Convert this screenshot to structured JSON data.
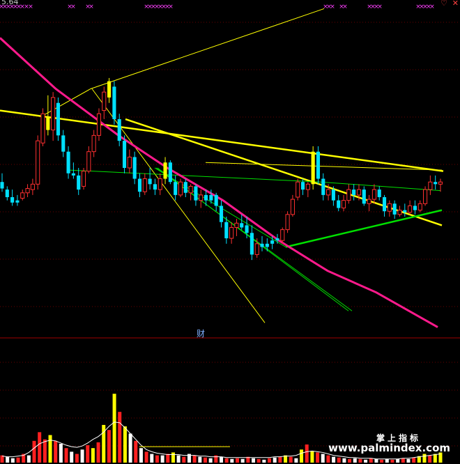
{
  "header": {
    "price": "5.64"
  },
  "indicator": {
    "label": "财"
  },
  "watermark": {
    "brand": "掌上指标",
    "url": "www.palmindex.com"
  },
  "colors": {
    "up": "#ff3030",
    "down": "#00e0ff",
    "highlight": "#ffff00",
    "ma_pink": "#ff1a8c",
    "trend_yellow": "#ffff00",
    "trend_green": "#00e000",
    "vol_up": "#ff2020",
    "vol_hl": "#ffff00",
    "vol_ma": "#ffffff",
    "marker": "#ff40ff"
  },
  "chart_data": {
    "type": "candlestick",
    "title": "",
    "ylim": [
      3.7,
      6.8
    ],
    "candles": [
      {
        "o": 5.12,
        "h": 5.2,
        "l": 5.03,
        "c": 5.06,
        "t": "d"
      },
      {
        "o": 5.05,
        "h": 5.08,
        "l": 4.95,
        "c": 4.98,
        "t": "d"
      },
      {
        "o": 4.98,
        "h": 5.05,
        "l": 4.9,
        "c": 4.93,
        "t": "d"
      },
      {
        "o": 4.93,
        "h": 5.0,
        "l": 4.9,
        "c": 4.95,
        "t": "d"
      },
      {
        "o": 4.97,
        "h": 5.05,
        "l": 4.95,
        "c": 5.02,
        "t": "u"
      },
      {
        "o": 5.02,
        "h": 5.1,
        "l": 4.98,
        "c": 5.06,
        "t": "u"
      },
      {
        "o": 5.05,
        "h": 5.15,
        "l": 5.0,
        "c": 5.1,
        "t": "u"
      },
      {
        "o": 5.1,
        "h": 5.55,
        "l": 5.05,
        "c": 5.5,
        "t": "u"
      },
      {
        "o": 5.48,
        "h": 5.8,
        "l": 5.45,
        "c": 5.75,
        "t": "u"
      },
      {
        "o": 5.72,
        "h": 5.92,
        "l": 5.55,
        "c": 5.6,
        "t": "h"
      },
      {
        "o": 5.6,
        "h": 5.95,
        "l": 5.5,
        "c": 5.9,
        "t": "u"
      },
      {
        "o": 5.85,
        "h": 5.9,
        "l": 5.5,
        "c": 5.55,
        "t": "d"
      },
      {
        "o": 5.55,
        "h": 5.6,
        "l": 5.35,
        "c": 5.4,
        "t": "d"
      },
      {
        "o": 5.4,
        "h": 5.45,
        "l": 5.15,
        "c": 5.2,
        "t": "d"
      },
      {
        "o": 5.2,
        "h": 5.3,
        "l": 5.15,
        "c": 5.18,
        "t": "d"
      },
      {
        "o": 5.18,
        "h": 5.25,
        "l": 5.0,
        "c": 5.05,
        "t": "d"
      },
      {
        "o": 5.08,
        "h": 5.25,
        "l": 5.05,
        "c": 5.22,
        "t": "u"
      },
      {
        "o": 5.22,
        "h": 5.45,
        "l": 5.2,
        "c": 5.4,
        "t": "u"
      },
      {
        "o": 5.4,
        "h": 5.6,
        "l": 5.35,
        "c": 5.55,
        "t": "u"
      },
      {
        "o": 5.55,
        "h": 5.8,
        "l": 5.5,
        "c": 5.75,
        "t": "u"
      },
      {
        "o": 5.78,
        "h": 6.0,
        "l": 5.7,
        "c": 5.95,
        "t": "u"
      },
      {
        "o": 5.9,
        "h": 6.08,
        "l": 5.85,
        "c": 6.05,
        "t": "h"
      },
      {
        "o": 6.0,
        "h": 6.05,
        "l": 5.65,
        "c": 5.7,
        "t": "d"
      },
      {
        "o": 5.7,
        "h": 5.75,
        "l": 5.45,
        "c": 5.5,
        "t": "d"
      },
      {
        "o": 5.5,
        "h": 5.55,
        "l": 5.2,
        "c": 5.25,
        "t": "d"
      },
      {
        "o": 5.25,
        "h": 5.42,
        "l": 5.2,
        "c": 5.35,
        "t": "u"
      },
      {
        "o": 5.35,
        "h": 5.4,
        "l": 5.1,
        "c": 5.15,
        "t": "d"
      },
      {
        "o": 5.15,
        "h": 5.2,
        "l": 4.98,
        "c": 5.03,
        "t": "d"
      },
      {
        "o": 5.03,
        "h": 5.2,
        "l": 5.0,
        "c": 5.15,
        "t": "u"
      },
      {
        "o": 5.15,
        "h": 5.25,
        "l": 5.05,
        "c": 5.1,
        "t": "d"
      },
      {
        "o": 5.1,
        "h": 5.15,
        "l": 5.0,
        "c": 5.05,
        "t": "d"
      },
      {
        "o": 5.05,
        "h": 5.2,
        "l": 5.0,
        "c": 5.15,
        "t": "u"
      },
      {
        "o": 5.15,
        "h": 5.35,
        "l": 5.1,
        "c": 5.3,
        "t": "h"
      },
      {
        "o": 5.3,
        "h": 5.32,
        "l": 5.1,
        "c": 5.12,
        "t": "d"
      },
      {
        "o": 5.12,
        "h": 5.18,
        "l": 4.95,
        "c": 5.0,
        "t": "d"
      },
      {
        "o": 5.0,
        "h": 5.15,
        "l": 4.98,
        "c": 5.12,
        "t": "u"
      },
      {
        "o": 5.12,
        "h": 5.15,
        "l": 4.98,
        "c": 5.02,
        "t": "d"
      },
      {
        "o": 5.02,
        "h": 5.1,
        "l": 4.95,
        "c": 5.08,
        "t": "u"
      },
      {
        "o": 5.08,
        "h": 5.1,
        "l": 4.9,
        "c": 4.95,
        "t": "d"
      },
      {
        "o": 4.95,
        "h": 5.05,
        "l": 4.88,
        "c": 5.0,
        "t": "u"
      },
      {
        "o": 5.0,
        "h": 5.05,
        "l": 4.9,
        "c": 4.95,
        "t": "d"
      },
      {
        "o": 4.95,
        "h": 5.05,
        "l": 4.92,
        "c": 5.0,
        "t": "d"
      },
      {
        "o": 5.0,
        "h": 5.02,
        "l": 4.85,
        "c": 4.9,
        "t": "d"
      },
      {
        "o": 4.9,
        "h": 4.95,
        "l": 4.7,
        "c": 4.75,
        "t": "d"
      },
      {
        "o": 4.75,
        "h": 4.8,
        "l": 4.55,
        "c": 4.6,
        "t": "d"
      },
      {
        "o": 4.6,
        "h": 4.75,
        "l": 4.55,
        "c": 4.7,
        "t": "u"
      },
      {
        "o": 4.7,
        "h": 4.78,
        "l": 4.62,
        "c": 4.74,
        "t": "u"
      },
      {
        "o": 4.74,
        "h": 4.82,
        "l": 4.68,
        "c": 4.7,
        "t": "d"
      },
      {
        "o": 4.72,
        "h": 4.8,
        "l": 4.6,
        "c": 4.65,
        "t": "d"
      },
      {
        "o": 4.65,
        "h": 4.72,
        "l": 4.4,
        "c": 4.45,
        "t": "d"
      },
      {
        "o": 4.45,
        "h": 4.6,
        "l": 4.42,
        "c": 4.55,
        "t": "u"
      },
      {
        "o": 4.55,
        "h": 4.62,
        "l": 4.48,
        "c": 4.52,
        "t": "d"
      },
      {
        "o": 4.52,
        "h": 4.6,
        "l": 4.48,
        "c": 4.55,
        "t": "d"
      },
      {
        "o": 4.55,
        "h": 4.62,
        "l": 4.5,
        "c": 4.58,
        "t": "d"
      },
      {
        "o": 4.58,
        "h": 4.64,
        "l": 4.55,
        "c": 4.6,
        "t": "d"
      },
      {
        "o": 4.58,
        "h": 4.7,
        "l": 4.55,
        "c": 4.68,
        "t": "u"
      },
      {
        "o": 4.68,
        "h": 4.85,
        "l": 4.65,
        "c": 4.82,
        "t": "u"
      },
      {
        "o": 4.82,
        "h": 5.0,
        "l": 4.8,
        "c": 4.96,
        "t": "u"
      },
      {
        "o": 4.98,
        "h": 5.15,
        "l": 4.95,
        "c": 5.12,
        "t": "u"
      },
      {
        "o": 5.12,
        "h": 5.15,
        "l": 5.0,
        "c": 5.05,
        "t": "d"
      },
      {
        "o": 5.05,
        "h": 5.12,
        "l": 4.98,
        "c": 5.1,
        "t": "u"
      },
      {
        "o": 5.1,
        "h": 5.45,
        "l": 5.05,
        "c": 5.4,
        "t": "h"
      },
      {
        "o": 5.4,
        "h": 5.45,
        "l": 5.1,
        "c": 5.15,
        "t": "d"
      },
      {
        "o": 5.15,
        "h": 5.2,
        "l": 4.95,
        "c": 5.0,
        "t": "d"
      },
      {
        "o": 5.0,
        "h": 5.1,
        "l": 4.95,
        "c": 5.05,
        "t": "u"
      },
      {
        "o": 5.05,
        "h": 5.08,
        "l": 4.9,
        "c": 4.95,
        "t": "d"
      },
      {
        "o": 4.95,
        "h": 5.0,
        "l": 4.85,
        "c": 4.88,
        "t": "d"
      },
      {
        "o": 4.88,
        "h": 5.0,
        "l": 4.85,
        "c": 4.95,
        "t": "u"
      },
      {
        "o": 4.95,
        "h": 5.1,
        "l": 4.92,
        "c": 5.05,
        "t": "u"
      },
      {
        "o": 5.05,
        "h": 5.1,
        "l": 4.95,
        "c": 5.0,
        "t": "d"
      },
      {
        "o": 5.0,
        "h": 5.1,
        "l": 4.95,
        "c": 5.05,
        "t": "u"
      },
      {
        "o": 5.05,
        "h": 5.08,
        "l": 4.9,
        "c": 4.92,
        "t": "d"
      },
      {
        "o": 4.92,
        "h": 5.0,
        "l": 4.85,
        "c": 4.96,
        "t": "u"
      },
      {
        "o": 4.96,
        "h": 5.1,
        "l": 4.92,
        "c": 5.05,
        "t": "u"
      },
      {
        "o": 5.05,
        "h": 5.08,
        "l": 4.95,
        "c": 4.98,
        "t": "d"
      },
      {
        "o": 4.98,
        "h": 5.0,
        "l": 4.8,
        "c": 4.85,
        "t": "d"
      },
      {
        "o": 4.85,
        "h": 4.95,
        "l": 4.8,
        "c": 4.92,
        "t": "u"
      },
      {
        "o": 4.92,
        "h": 4.95,
        "l": 4.78,
        "c": 4.82,
        "t": "d"
      },
      {
        "o": 4.82,
        "h": 4.9,
        "l": 4.8,
        "c": 4.86,
        "t": "u"
      },
      {
        "o": 4.86,
        "h": 4.92,
        "l": 4.8,
        "c": 4.84,
        "t": "d"
      },
      {
        "o": 4.84,
        "h": 4.95,
        "l": 4.82,
        "c": 4.9,
        "t": "u"
      },
      {
        "o": 4.9,
        "h": 4.95,
        "l": 4.82,
        "c": 4.86,
        "t": "d"
      },
      {
        "o": 4.86,
        "h": 4.95,
        "l": 4.84,
        "c": 4.92,
        "t": "u"
      },
      {
        "o": 4.92,
        "h": 5.08,
        "l": 4.9,
        "c": 5.05,
        "t": "u"
      },
      {
        "o": 5.05,
        "h": 5.18,
        "l": 5.0,
        "c": 5.12,
        "t": "u"
      },
      {
        "o": 5.12,
        "h": 5.18,
        "l": 5.05,
        "c": 5.1,
        "t": "d"
      },
      {
        "o": 5.1,
        "h": 5.15,
        "l": 5.03,
        "c": 5.12,
        "t": "u"
      }
    ],
    "pink_ma": [
      [
        0,
        6.45
      ],
      [
        80,
        5.98
      ],
      [
        170,
        5.55
      ],
      [
        240,
        5.25
      ],
      [
        320,
        4.95
      ],
      [
        400,
        4.58
      ],
      [
        470,
        4.3
      ],
      [
        540,
        4.1
      ],
      [
        628,
        3.78
      ]
    ],
    "trend_lines_yellow": [
      [
        [
          0,
          5.78
        ],
        [
          636,
          5.22
        ]
      ],
      [
        [
          58,
          5.72
        ],
        [
          130,
          5.98
        ],
        [
          465,
          6.72
        ]
      ],
      [
        [
          132,
          5.98
        ],
        [
          380,
          3.82
        ]
      ],
      [
        [
          180,
          5.7
        ],
        [
          634,
          4.72
        ]
      ],
      [
        [
          295,
          5.3
        ],
        [
          634,
          5.23
        ]
      ]
    ],
    "trend_lines_green": [
      [
        [
          99,
          5.23
        ],
        [
          460,
          5.12
        ],
        [
          632,
          5.04
        ]
      ],
      [
        [
          410,
          4.52
        ],
        [
          634,
          4.86
        ]
      ],
      [
        [
          222,
          5.25
        ],
        [
          410,
          4.52
        ]
      ],
      [
        [
          224,
          5.25
        ],
        [
          505,
          3.93
        ]
      ],
      [
        [
          226,
          5.25
        ],
        [
          500,
          3.93
        ]
      ]
    ],
    "volume": {
      "ylim": [
        0,
        1.0
      ],
      "bars": [
        {
          "v": 0.1,
          "t": "u"
        },
        {
          "v": 0.08,
          "t": "w"
        },
        {
          "v": 0.06,
          "t": "w"
        },
        {
          "v": 0.07,
          "t": "u"
        },
        {
          "v": 0.12,
          "t": "u"
        },
        {
          "v": 0.1,
          "t": "w"
        },
        {
          "v": 0.3,
          "t": "u"
        },
        {
          "v": 0.42,
          "t": "u"
        },
        {
          "v": 0.32,
          "t": "u"
        },
        {
          "v": 0.38,
          "t": "h"
        },
        {
          "v": 0.3,
          "t": "u"
        },
        {
          "v": 0.26,
          "t": "w"
        },
        {
          "v": 0.2,
          "t": "u"
        },
        {
          "v": 0.15,
          "t": "w"
        },
        {
          "v": 0.12,
          "t": "u"
        },
        {
          "v": 0.18,
          "t": "w"
        },
        {
          "v": 0.24,
          "t": "u"
        },
        {
          "v": 0.2,
          "t": "h"
        },
        {
          "v": 0.28,
          "t": "u"
        },
        {
          "v": 0.52,
          "t": "h"
        },
        {
          "v": 0.45,
          "t": "u"
        },
        {
          "v": 0.95,
          "t": "h"
        },
        {
          "v": 0.7,
          "t": "u"
        },
        {
          "v": 0.5,
          "t": "h"
        },
        {
          "v": 0.4,
          "t": "w"
        },
        {
          "v": 0.3,
          "t": "u"
        },
        {
          "v": 0.2,
          "t": "w"
        },
        {
          "v": 0.15,
          "t": "u"
        },
        {
          "v": 0.12,
          "t": "w"
        },
        {
          "v": 0.1,
          "t": "u"
        },
        {
          "v": 0.1,
          "t": "w"
        },
        {
          "v": 0.12,
          "t": "u"
        },
        {
          "v": 0.14,
          "t": "h"
        },
        {
          "v": 0.1,
          "t": "w"
        },
        {
          "v": 0.08,
          "t": "u"
        },
        {
          "v": 0.12,
          "t": "w"
        },
        {
          "v": 0.1,
          "t": "u"
        },
        {
          "v": 0.08,
          "t": "w"
        },
        {
          "v": 0.07,
          "t": "u"
        },
        {
          "v": 0.06,
          "t": "w"
        },
        {
          "v": 0.1,
          "t": "u"
        },
        {
          "v": 0.08,
          "t": "w"
        },
        {
          "v": 0.06,
          "t": "u"
        },
        {
          "v": 0.05,
          "t": "w"
        },
        {
          "v": 0.06,
          "t": "u"
        },
        {
          "v": 0.05,
          "t": "w"
        },
        {
          "v": 0.08,
          "t": "u"
        },
        {
          "v": 0.06,
          "t": "w"
        },
        {
          "v": 0.05,
          "t": "u"
        },
        {
          "v": 0.04,
          "t": "w"
        },
        {
          "v": 0.06,
          "t": "u"
        },
        {
          "v": 0.07,
          "t": "w"
        },
        {
          "v": 0.08,
          "t": "u"
        },
        {
          "v": 0.1,
          "t": "h"
        },
        {
          "v": 0.08,
          "t": "u"
        },
        {
          "v": 0.06,
          "t": "w"
        },
        {
          "v": 0.18,
          "t": "h"
        },
        {
          "v": 0.25,
          "t": "u"
        },
        {
          "v": 0.16,
          "t": "h"
        },
        {
          "v": 0.14,
          "t": "u"
        },
        {
          "v": 0.12,
          "t": "w"
        },
        {
          "v": 0.1,
          "t": "u"
        },
        {
          "v": 0.08,
          "t": "w"
        },
        {
          "v": 0.07,
          "t": "u"
        },
        {
          "v": 0.06,
          "t": "w"
        },
        {
          "v": 0.05,
          "t": "u"
        },
        {
          "v": 0.06,
          "t": "w"
        },
        {
          "v": 0.05,
          "t": "u"
        },
        {
          "v": 0.04,
          "t": "w"
        },
        {
          "v": 0.06,
          "t": "u"
        },
        {
          "v": 0.05,
          "t": "w"
        },
        {
          "v": 0.04,
          "t": "u"
        },
        {
          "v": 0.05,
          "t": "w"
        },
        {
          "v": 0.04,
          "t": "u"
        },
        {
          "v": 0.05,
          "t": "w"
        },
        {
          "v": 0.06,
          "t": "u"
        },
        {
          "v": 0.05,
          "t": "w"
        },
        {
          "v": 0.07,
          "t": "u"
        },
        {
          "v": 0.09,
          "t": "h"
        },
        {
          "v": 0.12,
          "t": "h"
        },
        {
          "v": 0.1,
          "t": "u"
        },
        {
          "v": 0.12,
          "t": "h"
        },
        {
          "v": 0.14,
          "t": "h"
        }
      ],
      "ma": [
        0.09,
        0.08,
        0.08,
        0.09,
        0.1,
        0.14,
        0.2,
        0.26,
        0.29,
        0.31,
        0.3,
        0.27,
        0.24,
        0.22,
        0.21,
        0.23,
        0.27,
        0.32,
        0.36,
        0.42,
        0.5,
        0.56,
        0.55,
        0.48,
        0.4,
        0.32,
        0.24,
        0.18,
        0.15,
        0.13,
        0.12,
        0.11,
        0.11,
        0.11,
        0.1,
        0.1,
        0.1,
        0.09,
        0.09,
        0.08,
        0.08,
        0.08,
        0.07,
        0.07,
        0.07,
        0.07,
        0.07,
        0.07,
        0.07,
        0.07,
        0.07,
        0.08,
        0.08,
        0.09,
        0.09,
        0.1,
        0.13,
        0.15,
        0.16,
        0.15,
        0.14,
        0.12,
        0.1,
        0.09,
        0.08,
        0.07,
        0.07,
        0.06,
        0.06,
        0.06,
        0.05,
        0.05,
        0.05,
        0.05,
        0.05,
        0.06,
        0.06,
        0.07,
        0.08,
        0.09,
        0.1,
        0.11,
        0.12
      ],
      "avg_line": 0.22
    },
    "markers_top": [
      2,
      7,
      12,
      17,
      22,
      27,
      32,
      38,
      44,
      100,
      105,
      126,
      131,
      210,
      215,
      220,
      225,
      230,
      235,
      240,
      245,
      467,
      472,
      477,
      490,
      495,
      530,
      535,
      540,
      545,
      600,
      605,
      610,
      615,
      620
    ]
  }
}
